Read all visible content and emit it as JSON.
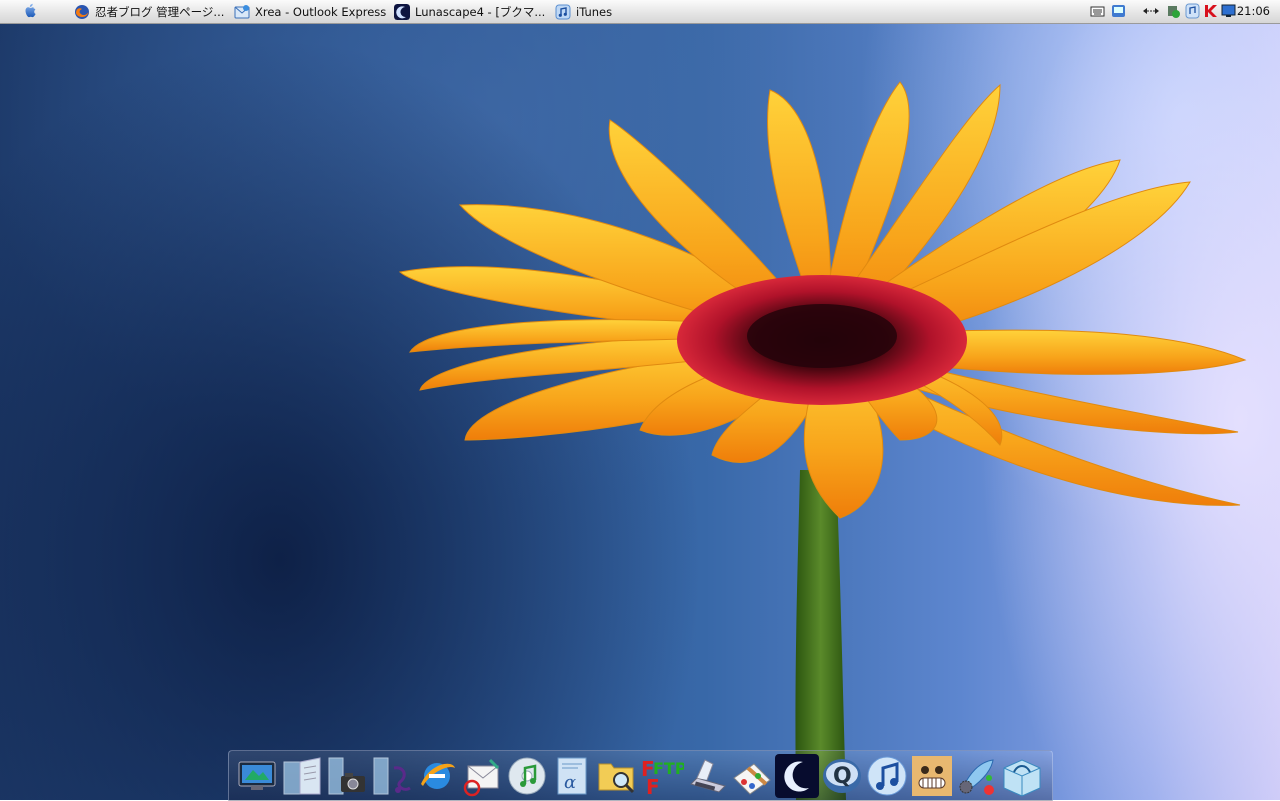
{
  "menubar": {
    "apple_menu": "apple-logo-icon",
    "tasks": [
      {
        "label": "忍者ブログ 管理ページ...",
        "icon": "firefox-icon"
      },
      {
        "label": "Xrea - Outlook Express",
        "icon": "outlook-express-icon"
      },
      {
        "label": "Lunascape4 - [ブクマ...",
        "icon": "lunascape-icon"
      },
      {
        "label": "iTunes",
        "icon": "itunes-icon"
      }
    ],
    "tray": [
      "keyboard-icon",
      "network-icon",
      "arrows-icon",
      "shield-icon",
      "itunes-icon",
      "k-icon",
      "display-icon"
    ],
    "clock": "21:06"
  },
  "desktop": {
    "wallpaper": "orange-gerbera-on-blue",
    "colors": {
      "petal": "#f8a81a",
      "petal_light": "#ffd24a",
      "center": "#b0122a",
      "stem": "#3f6e1a"
    }
  },
  "dock": {
    "items": [
      "desktop-monitor-icon",
      "documents-icon",
      "camera-icon",
      "music-folder-icon",
      "ie-icon",
      "mail-icon",
      "itunes-cd-icon",
      "text-editor-icon",
      "search-folder-icon",
      "ffftp-icon",
      "scanner-icon",
      "paint-icon",
      "lunascape-icon",
      "quicktime-icon",
      "itunes-icon",
      "face-app-icon",
      "settings-icon",
      "water-icon"
    ]
  }
}
